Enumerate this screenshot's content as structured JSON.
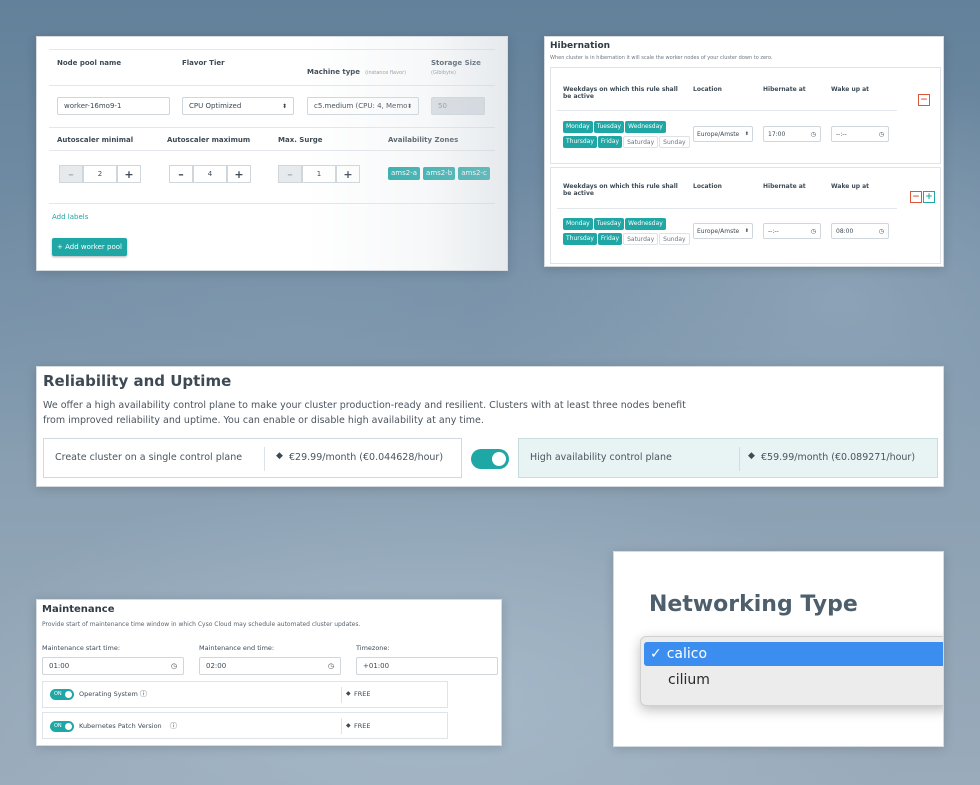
{
  "node_pool": {
    "headers": {
      "name": "Node pool name",
      "flavor": "Flavor Tier",
      "machine": "Machine type",
      "machine_sub": "(instance flavor)",
      "storage": "Storage Size",
      "storage_sub": "(Gibibyte)"
    },
    "name_value": "worker-16mo9-1",
    "flavor_value": "CPU Optimized",
    "machine_value": "c5.medium (CPU: 4, Memor",
    "storage_value": "50",
    "headers2": {
      "min": "Autoscaler minimal",
      "max": "Autoscaler maximum",
      "surge": "Max. Surge",
      "zones": "Availability Zones"
    },
    "min_value": "2",
    "max_value": "4",
    "surge_value": "1",
    "minus": "–",
    "plus": "+",
    "zones": [
      "ams2-a",
      "ams2-b",
      "ams2-c"
    ],
    "add_labels": "Add labels",
    "add_pool": "+ Add worker pool"
  },
  "hibernation": {
    "title": "Hibernation",
    "desc": "When cluster is in hibernation it will scale the worker nodes of your cluster down to zero.",
    "col_days": "Weekdays on which this rule shall be active",
    "col_location": "Location",
    "col_hibernate": "Hibernate at",
    "col_wake": "Wake up at",
    "days_row1": [
      "Monday",
      "Tuesday",
      "Wednesday"
    ],
    "days_row2": [
      "Thursday",
      "Friday",
      "Saturday",
      "Sunday"
    ],
    "rule1": {
      "location": "Europe/Amste",
      "hibernate": "17:00",
      "wake": "--:--"
    },
    "rule2": {
      "location": "Europe/Amste",
      "hibernate": "--:--",
      "wake": "08:00"
    },
    "remove": "−",
    "add": "+"
  },
  "reliability": {
    "title": "Reliability and Uptime",
    "desc1": "We offer a high availability control plane to make your cluster production-ready and resilient. Clusters with at least three nodes benefit",
    "desc2": "from improved reliability and uptime. You can enable or disable high availability at any time.",
    "single_label": "Create cluster on a single control plane",
    "single_price": "€29.99/month (€0.044628/hour)",
    "ha_label": "High availability control plane",
    "ha_price": "€59.99/month (€0.089271/hour)"
  },
  "maintenance": {
    "title": "Maintenance",
    "desc": "Provide start of maintenance time window in which Cyso Cloud may schedule automated cluster updates.",
    "start_label": "Maintenance start time:",
    "start_value": "01:00",
    "end_label": "Maintenance end time:",
    "end_value": "02:00",
    "tz_label": "Timezone:",
    "tz_value": "+01:00",
    "toggle_on": "ON",
    "os_label": "Operating System",
    "os_price": "FREE",
    "k8s_label": "Kubernetes Patch Version",
    "k8s_price": "FREE"
  },
  "networking": {
    "title": "Networking Type",
    "selected": "calico",
    "checkmark": "✓",
    "other": "cilium"
  },
  "colors": {
    "accent": "#1ea7a5",
    "danger": "#e0553a"
  }
}
